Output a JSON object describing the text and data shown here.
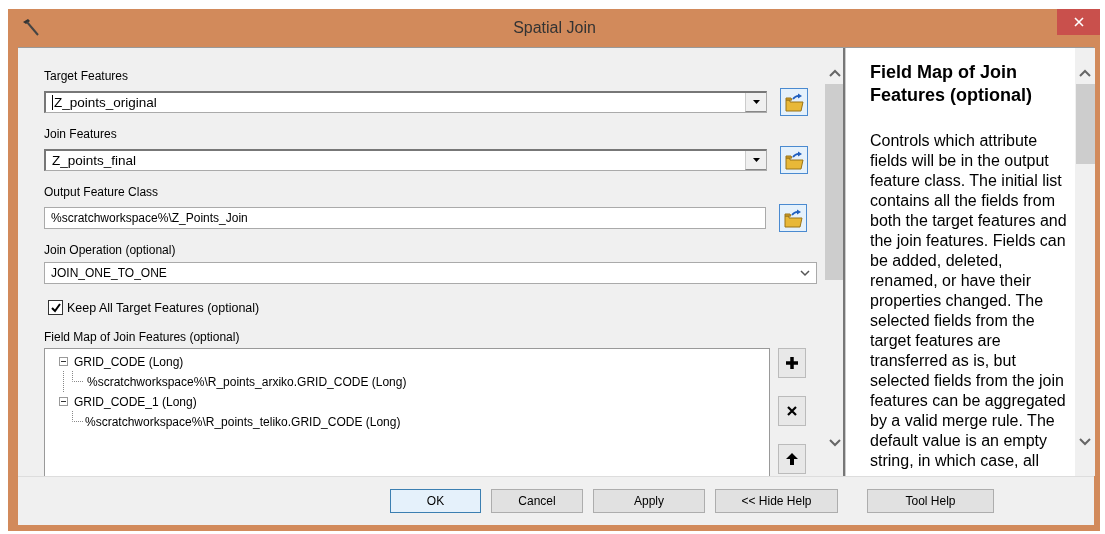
{
  "window": {
    "title": "Spatial Join"
  },
  "parameters": [
    {
      "kind": "combo",
      "label": "Target Features",
      "value": "Z_points_original",
      "focused": true
    },
    {
      "kind": "combo",
      "label": "Join Features",
      "value": "Z_points_final",
      "focused": false
    },
    {
      "kind": "path",
      "label": "Output Feature Class",
      "value": "%scratchworkspace%\\Z_Points_Join",
      "focused": false
    },
    {
      "kind": "select",
      "label": "Join Operation (optional)",
      "value": "JOIN_ONE_TO_ONE",
      "focused": false
    }
  ],
  "keep_all": {
    "label": "Keep All Target Features (optional)",
    "checked": true
  },
  "field_map": {
    "label": "Field Map of Join Features (optional)",
    "items": [
      {
        "label": "GRID_CODE (Long)",
        "expanded": true,
        "children": [
          {
            "label": "%scratchworkspace%\\R_points_arxiko.GRID_CODE (Long)"
          }
        ]
      },
      {
        "label": "GRID_CODE_1 (Long)",
        "expanded": true,
        "children": [
          {
            "label": "%scratchworkspace%\\R_points_teliko.GRID_CODE (Long)"
          }
        ]
      }
    ]
  },
  "help": {
    "title": "Field Map of Join Features (optional)",
    "body": "Controls which attribute fields will be in the output feature class. The initial list contains all the fields from both the target features and the join features. Fields can be added, deleted, renamed, or have their properties changed. The selected fields from the target features are transferred as is, but selected fields from the join features can be aggregated by a valid merge rule. The default value is an empty string, in which case, all"
  },
  "buttons": [
    {
      "label": "OK",
      "selected": true
    },
    {
      "label": "Cancel",
      "selected": false
    },
    {
      "label": "Apply",
      "selected": false
    },
    {
      "label": "<< Hide Help",
      "selected": false
    },
    {
      "label": "Tool Help",
      "selected": false
    }
  ]
}
